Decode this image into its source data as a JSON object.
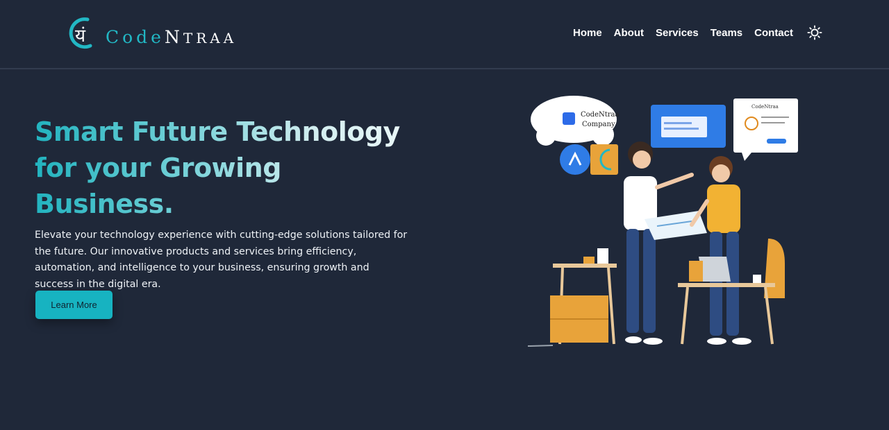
{
  "brand": {
    "logo_glyph": "यं",
    "name_part1": "CodeN",
    "name_part1_a": "Code",
    "name_part1_b": "N",
    "name_part2": "traa"
  },
  "nav": {
    "items": [
      {
        "label": "Home"
      },
      {
        "label": "About"
      },
      {
        "label": "Services"
      },
      {
        "label": "Teams"
      },
      {
        "label": "Contact"
      }
    ],
    "theme_icon": "sun-icon"
  },
  "hero": {
    "title_line1": "Smart Future Technology",
    "title_line2": "for your Growing",
    "title_line3": "Business.",
    "description": "Elevate your technology experience with cutting-edge solutions tailored for the future. Our innovative products and services bring efficiency, automation, and intelligence to your business, ensuring growth and success in the digital era.",
    "cta_label": "Learn More"
  },
  "illustration": {
    "bubble_brand": "CodeNtraa",
    "bubble_company": "Company",
    "card_brand": "CodeNtraa"
  },
  "colors": {
    "background": "#1f2839",
    "accent": "#17b3c1",
    "heading_gradient_start": "#22b3bf",
    "heading_gradient_end": "#f2fbfb"
  }
}
